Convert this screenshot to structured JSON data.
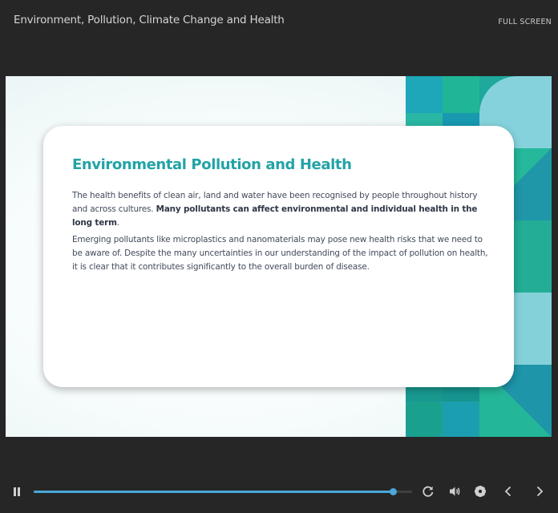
{
  "header": {
    "title": "Environment, Pollution, Climate Change and Health",
    "fullscreen_label": "FULL SCREEN"
  },
  "slide": {
    "heading": "Environmental Pollution and Health",
    "paragraph1_text": "The health benefits of clean air, land and water have been recognised by people throughout history and across cultures. ",
    "paragraph1_bold": "Many pollutants can affect environmental and individual health in the long term",
    "paragraph1_end": ".",
    "paragraph2": "Emerging pollutants like microplastics and nanomaterials may pose new health risks that we need to be aware of. Despite the many uncertainties in our understanding of the impact of pollution on health, it is clear that it contributes significantly to the overall burden of disease."
  },
  "player": {
    "progress": 0.95,
    "icons": [
      "pause-icon",
      "replay-icon",
      "volume-icon",
      "settings-icon",
      "previous-icon",
      "next-icon"
    ]
  },
  "colors": {
    "accent": "#22a3a6",
    "progress": "#4aa8d8",
    "background": "#262626"
  }
}
